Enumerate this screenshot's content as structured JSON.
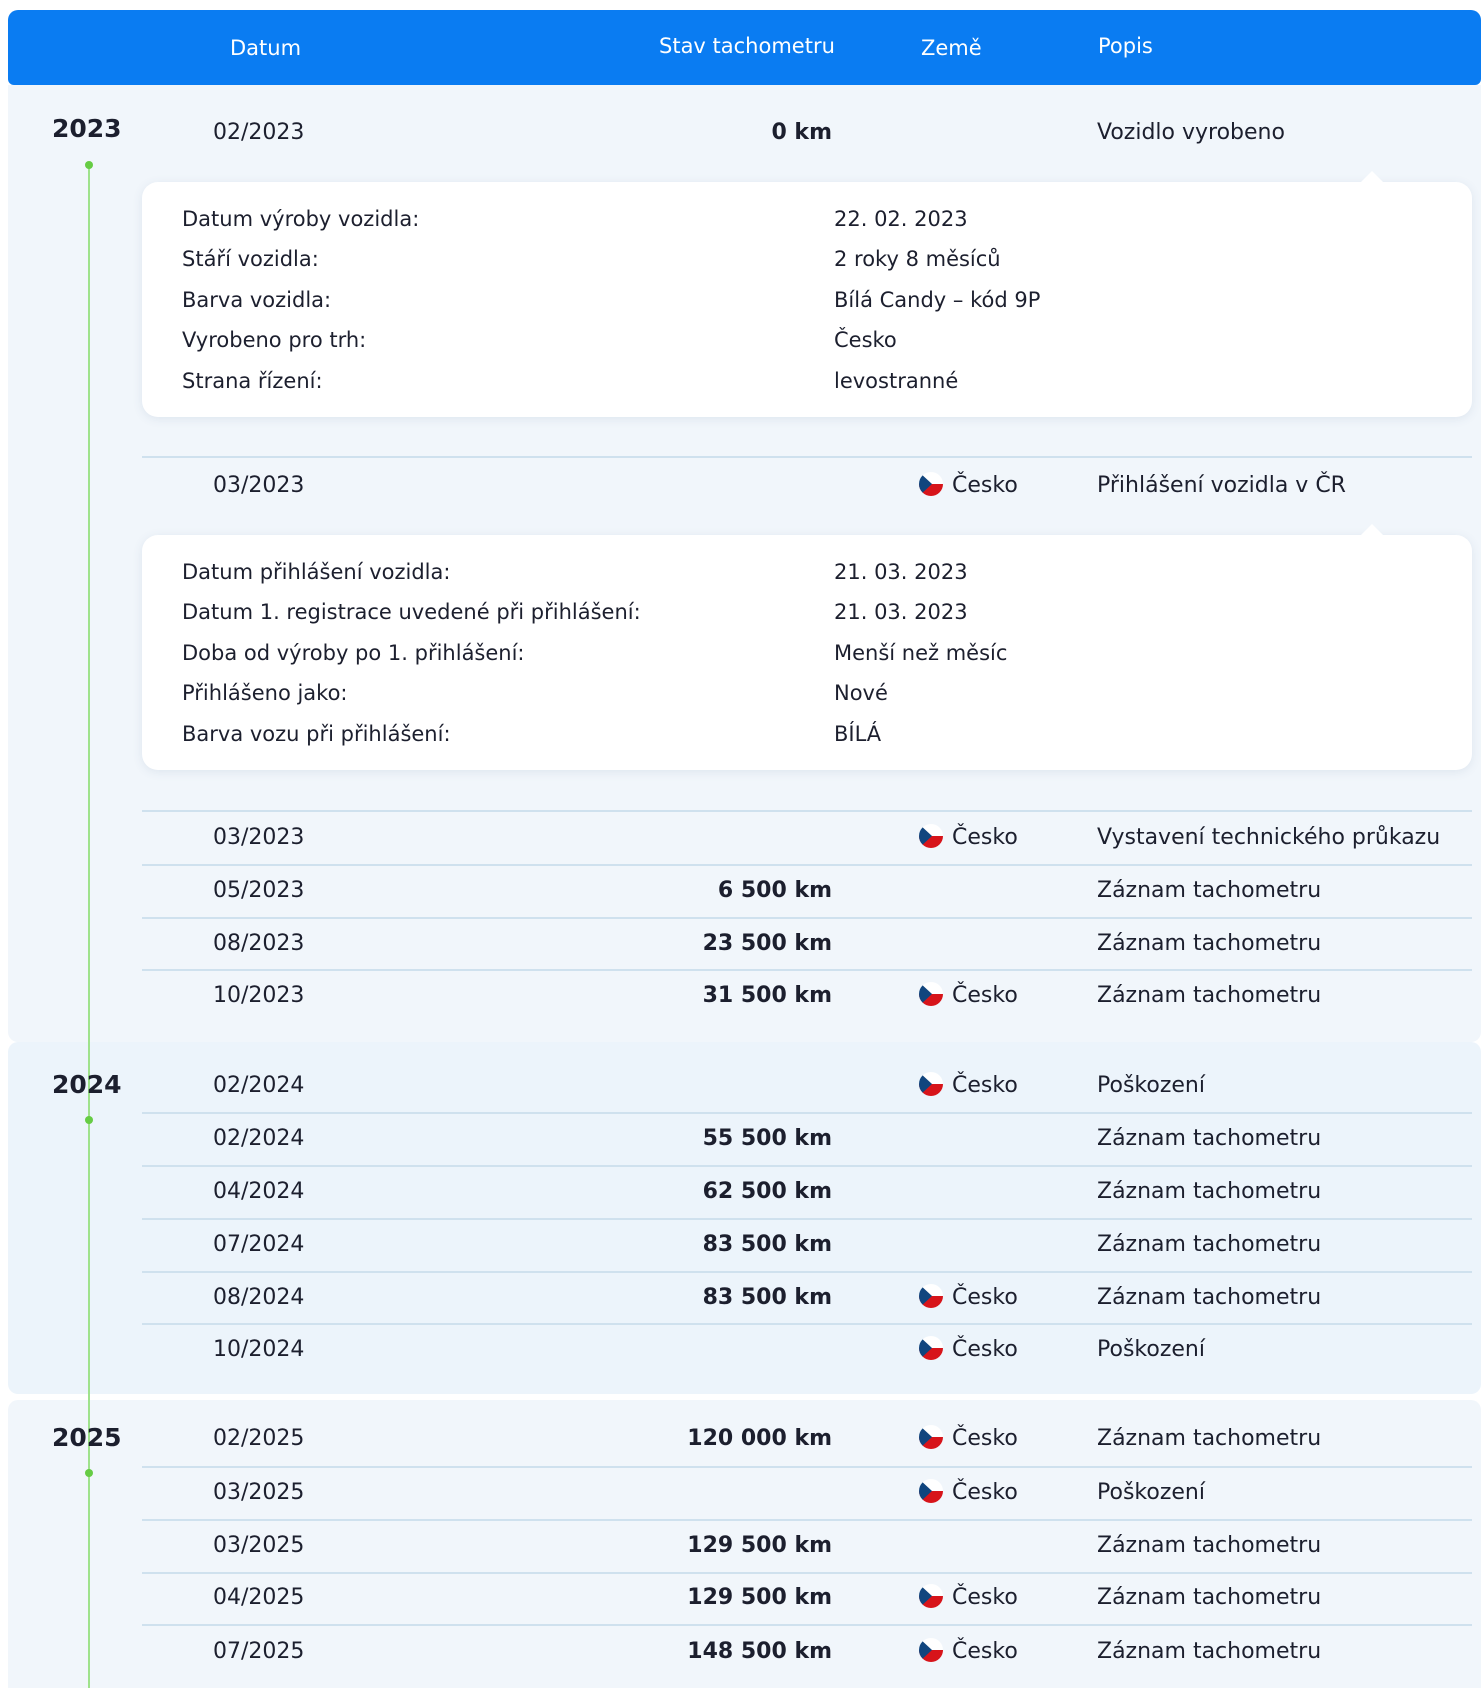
{
  "header": {
    "col_date": "Datum",
    "col_km": "Stav tachometru",
    "col_country": "Země",
    "col_desc": "Popis"
  },
  "years": [
    "2023",
    "2024",
    "2025"
  ],
  "rows_2023": [
    {
      "date": "02/2023",
      "km": "0 km",
      "country": "",
      "desc": "Vozidlo vyrobeno"
    },
    {
      "date": "03/2023",
      "km": "",
      "country": "Česko",
      "desc": "Přihlášení vozidla v ČR"
    },
    {
      "date": "03/2023",
      "km": "",
      "country": "Česko",
      "desc": "Vystavení technického průkazu"
    },
    {
      "date": "05/2023",
      "km": "6 500 km",
      "country": "",
      "desc": "Záznam tachometru"
    },
    {
      "date": "08/2023",
      "km": "23 500 km",
      "country": "",
      "desc": "Záznam tachometru"
    },
    {
      "date": "10/2023",
      "km": "31 500 km",
      "country": "Česko",
      "desc": "Záznam tachometru"
    }
  ],
  "rows_2024": [
    {
      "date": "02/2024",
      "km": "",
      "country": "Česko",
      "desc": "Poškození"
    },
    {
      "date": "02/2024",
      "km": "55 500 km",
      "country": "",
      "desc": "Záznam tachometru"
    },
    {
      "date": "04/2024",
      "km": "62 500 km",
      "country": "",
      "desc": "Záznam tachometru"
    },
    {
      "date": "07/2024",
      "km": "83 500 km",
      "country": "",
      "desc": "Záznam tachometru"
    },
    {
      "date": "08/2024",
      "km": "83 500 km",
      "country": "Česko",
      "desc": "Záznam tachometru"
    },
    {
      "date": "10/2024",
      "km": "",
      "country": "Česko",
      "desc": "Poškození"
    }
  ],
  "rows_2025": [
    {
      "date": "02/2025",
      "km": "120 000 km",
      "country": "Česko",
      "desc": "Záznam tachometru"
    },
    {
      "date": "03/2025",
      "km": "",
      "country": "Česko",
      "desc": "Poškození"
    },
    {
      "date": "03/2025",
      "km": "129 500 km",
      "country": "",
      "desc": "Záznam tachometru"
    },
    {
      "date": "04/2025",
      "km": "129 500 km",
      "country": "Česko",
      "desc": "Záznam tachometru"
    },
    {
      "date": "07/2025",
      "km": "148 500 km",
      "country": "Česko",
      "desc": "Záznam tachometru"
    }
  ],
  "card_production": [
    {
      "k": "Datum výroby vozidla:",
      "v": "22. 02. 2023"
    },
    {
      "k": "Stáří vozidla:",
      "v": "2 roky 8 měsíců"
    },
    {
      "k": "Barva vozidla:",
      "v": "Bílá Candy – kód 9P"
    },
    {
      "k": "Vyrobeno pro trh:",
      "v": "Česko"
    },
    {
      "k": "Strana řízení:",
      "v": "levostranné"
    }
  ],
  "card_registration": [
    {
      "k": "Datum přihlášení vozidla:",
      "v": "21. 03. 2023"
    },
    {
      "k": "Datum 1. registrace uvedené při přihlášení:",
      "v": "21. 03. 2023"
    },
    {
      "k": "Doba od výroby po 1. přihlášení:",
      "v": "Menší než měsíc"
    },
    {
      "k": "Přihlášeno jako:",
      "v": "Nové"
    },
    {
      "k": "Barva vozu při přihlášení:",
      "v": "BÍLÁ"
    }
  ],
  "colors": {
    "header": "#0a7cf2",
    "timeline_dot": "#66cc44",
    "row_bg": "#f1f6fb"
  }
}
